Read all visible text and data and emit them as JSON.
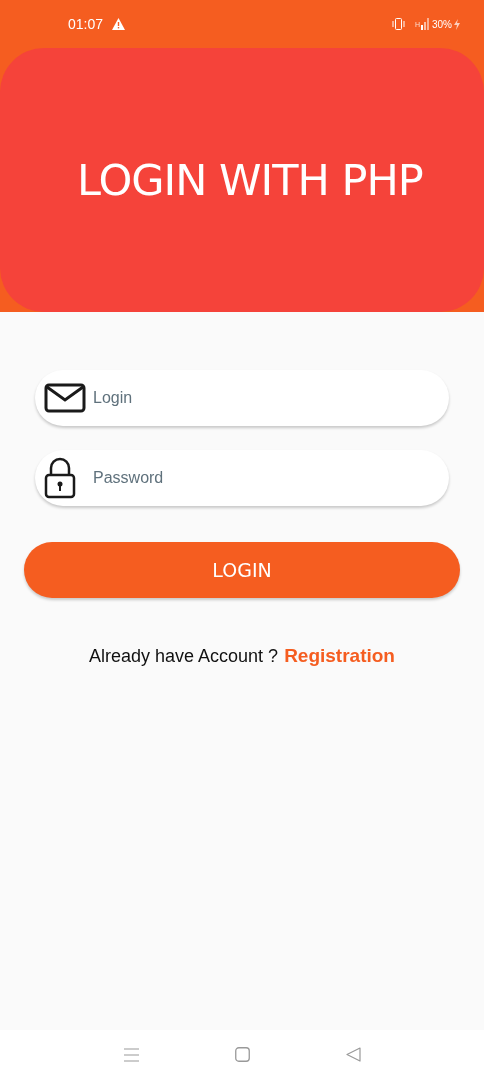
{
  "status_bar": {
    "time": "01:07",
    "network": "H",
    "battery": "30%"
  },
  "header": {
    "title": "LOGIN WITH PHP"
  },
  "fields": [
    {
      "kind": "email",
      "placeholder": "Login"
    },
    {
      "kind": "password",
      "placeholder": "Password"
    }
  ],
  "login_button": "LOGIN",
  "footer": {
    "text": "Already have Account ?",
    "link": "Registration"
  }
}
